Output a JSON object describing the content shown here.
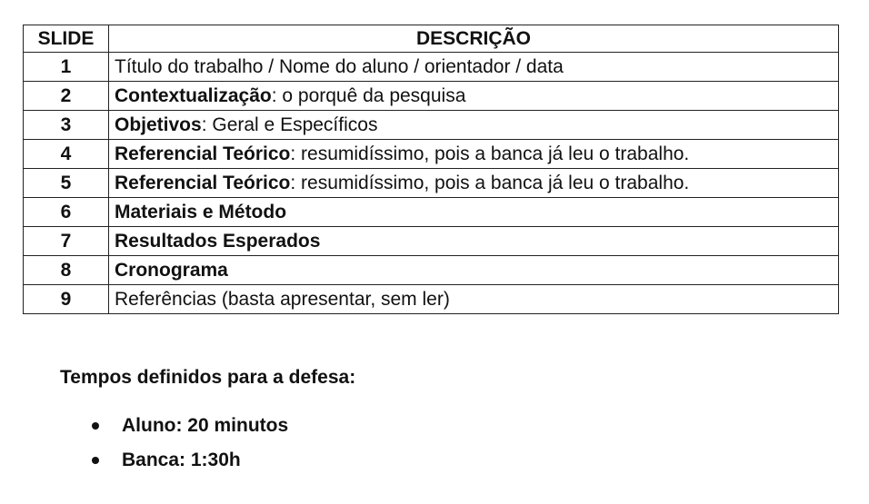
{
  "table": {
    "headers": {
      "slide": "SLIDE",
      "description": "DESCRIÇÃO"
    },
    "rows": [
      {
        "num": "1",
        "bold": "",
        "rest": "Título do trabalho / Nome do aluno / orientador / data"
      },
      {
        "num": "2",
        "bold": "Contextualização",
        "rest": ": o porquê da pesquisa"
      },
      {
        "num": "3",
        "bold": "Objetivos",
        "rest": ": Geral e Específicos"
      },
      {
        "num": "4",
        "bold": "Referencial Teórico",
        "rest": ": resumidíssimo, pois a banca já leu o trabalho."
      },
      {
        "num": "5",
        "bold": "Referencial Teórico",
        "rest": ": resumidíssimo, pois a banca já leu o trabalho."
      },
      {
        "num": "6",
        "bold": "Materiais e Método",
        "rest": ""
      },
      {
        "num": "7",
        "bold": "Resultados Esperados",
        "rest": ""
      },
      {
        "num": "8",
        "bold": "Cronograma",
        "rest": ""
      },
      {
        "num": "9",
        "bold": "",
        "rest": "Referências (basta apresentar, sem ler)"
      }
    ]
  },
  "times": {
    "heading": "Tempos definidos para a defesa:",
    "items": [
      "Aluno: 20 minutos",
      "Banca: 1:30h"
    ]
  }
}
